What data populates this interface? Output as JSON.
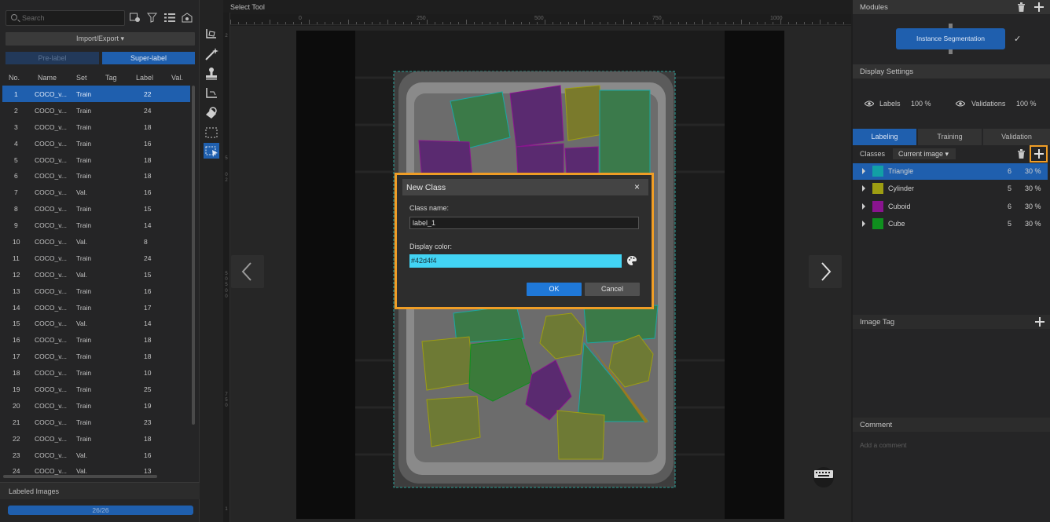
{
  "left_panel": {
    "search_placeholder": "Search",
    "import_export_label": "Import/Export ▾",
    "prelabel_label": "Pre-label",
    "superlabel_label": "Super-label",
    "columns": [
      "No.",
      "Name",
      "Set",
      "Tag",
      "Label",
      "Val."
    ],
    "rows": [
      {
        "no": "1",
        "name": "COCO_v...",
        "set": "Train",
        "label": "22"
      },
      {
        "no": "2",
        "name": "COCO_v...",
        "set": "Train",
        "label": "24"
      },
      {
        "no": "3",
        "name": "COCO_v...",
        "set": "Train",
        "label": "18"
      },
      {
        "no": "4",
        "name": "COCO_v...",
        "set": "Train",
        "label": "16"
      },
      {
        "no": "5",
        "name": "COCO_v...",
        "set": "Train",
        "label": "18"
      },
      {
        "no": "6",
        "name": "COCO_v...",
        "set": "Train",
        "label": "18"
      },
      {
        "no": "7",
        "name": "COCO_v...",
        "set": "Val.",
        "label": "16"
      },
      {
        "no": "8",
        "name": "COCO_v...",
        "set": "Train",
        "label": "15"
      },
      {
        "no": "9",
        "name": "COCO_v...",
        "set": "Train",
        "label": "14"
      },
      {
        "no": "10",
        "name": "COCO_v...",
        "set": "Val.",
        "label": "8"
      },
      {
        "no": "11",
        "name": "COCO_v...",
        "set": "Train",
        "label": "24"
      },
      {
        "no": "12",
        "name": "COCO_v...",
        "set": "Val.",
        "label": "15"
      },
      {
        "no": "13",
        "name": "COCO_v...",
        "set": "Train",
        "label": "16"
      },
      {
        "no": "14",
        "name": "COCO_v...",
        "set": "Train",
        "label": "17"
      },
      {
        "no": "15",
        "name": "COCO_v...",
        "set": "Val.",
        "label": "14"
      },
      {
        "no": "16",
        "name": "COCO_v...",
        "set": "Train",
        "label": "18"
      },
      {
        "no": "17",
        "name": "COCO_v...",
        "set": "Train",
        "label": "18"
      },
      {
        "no": "18",
        "name": "COCO_v...",
        "set": "Train",
        "label": "10"
      },
      {
        "no": "19",
        "name": "COCO_v...",
        "set": "Train",
        "label": "25"
      },
      {
        "no": "20",
        "name": "COCO_v...",
        "set": "Train",
        "label": "19"
      },
      {
        "no": "21",
        "name": "COCO_v...",
        "set": "Train",
        "label": "23"
      },
      {
        "no": "22",
        "name": "COCO_v...",
        "set": "Train",
        "label": "18"
      },
      {
        "no": "23",
        "name": "COCO_v...",
        "set": "Val.",
        "label": "16"
      },
      {
        "no": "24",
        "name": "COCO_v...",
        "set": "Val.",
        "label": "13"
      }
    ],
    "selected_row": 0,
    "labeled_images_label": "Labeled Images",
    "progress_text": "26/26",
    "progress_fraction": 1.0
  },
  "canvas": {
    "title": "Select Tool",
    "ruler_labels": [
      "0",
      "250",
      "500",
      "750",
      "1000"
    ],
    "vruler_labels": [
      "2",
      "5",
      "0",
      "2",
      "5",
      "0",
      "5",
      "0",
      "0",
      "7",
      "5",
      "0",
      "1"
    ]
  },
  "dialog": {
    "title": "New Class",
    "close_glyph": "×",
    "class_name_label": "Class name:",
    "class_name_value": "label_1",
    "display_color_label": "Display color:",
    "display_color_value": "#42d4f4",
    "ok_label": "OK",
    "cancel_label": "Cancel"
  },
  "right_panel": {
    "modules_label": "Modules",
    "module_name": "Instance Segmentation",
    "module_check": "✓",
    "display_settings_label": "Display Settings",
    "labels_text": "Labels",
    "labels_pct": "100 %",
    "validations_text": "Validations",
    "validations_pct": "100 %",
    "tabs": [
      "Labeling",
      "Training",
      "Validation"
    ],
    "active_tab": 0,
    "classes_label": "Classes",
    "classes_filter": "Current image ▾",
    "classes": [
      {
        "name": "Triangle",
        "count": "6",
        "pct": "30 %",
        "color": "#12a0a5"
      },
      {
        "name": "Cylinder",
        "count": "5",
        "pct": "30 %",
        "color": "#9e9e12"
      },
      {
        "name": "Cuboid",
        "count": "6",
        "pct": "30 %",
        "color": "#8a148f"
      },
      {
        "name": "Cube",
        "count": "5",
        "pct": "30 %",
        "color": "#0f8f1e"
      }
    ],
    "image_tag_label": "Image Tag",
    "comment_label": "Comment",
    "comment_placeholder": "Add a comment"
  },
  "colors": {
    "accent": "#1f5fae",
    "highlight": "#ef9d26",
    "dialog_color_swatch": "#42d4f4",
    "ok_blue": "#1f78d8"
  }
}
